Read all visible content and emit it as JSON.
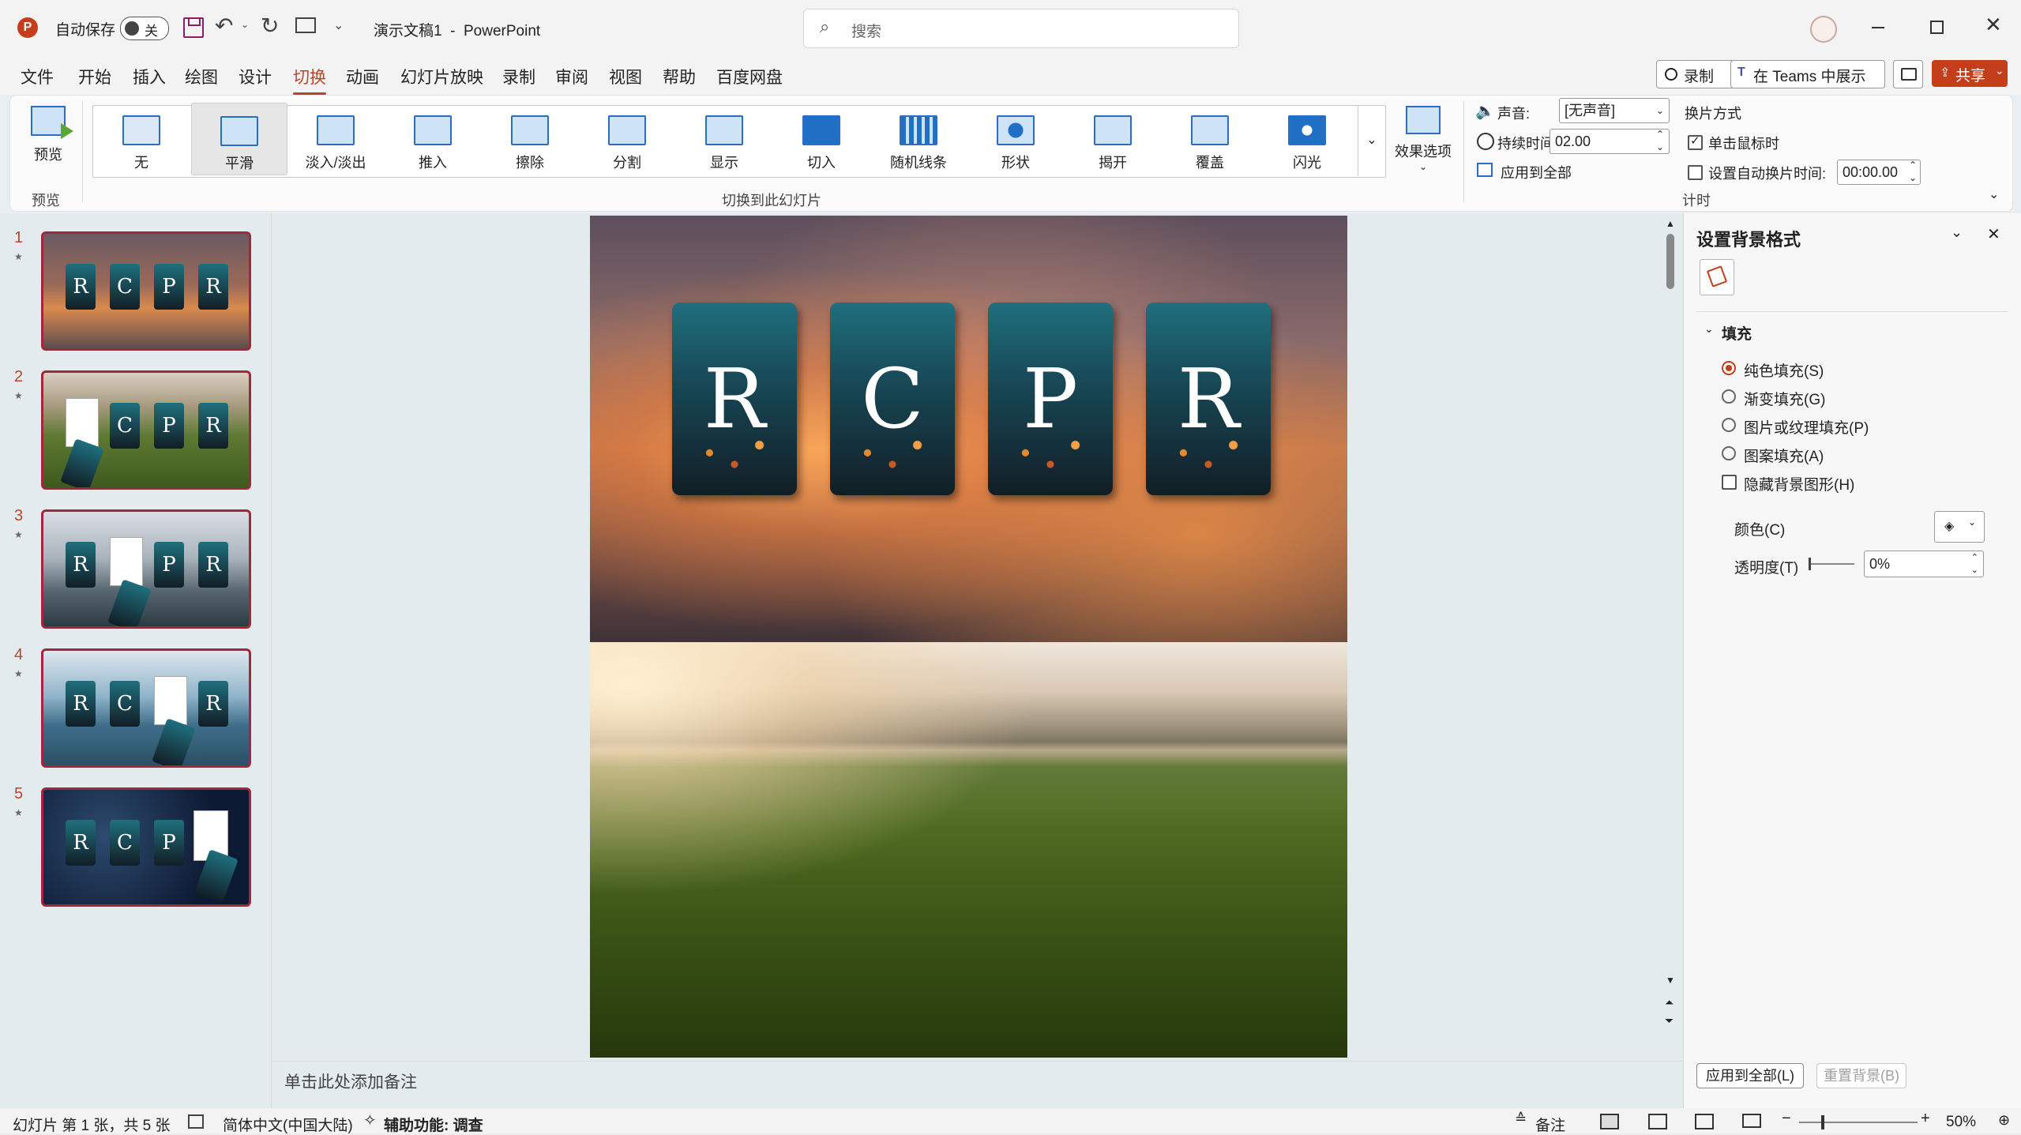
{
  "app": {
    "autosave_label": "自动保存",
    "autosave_state": "关",
    "doc_title": "演示文稿1  -  PowerPoint",
    "search_placeholder": "搜索"
  },
  "menu": [
    "文件",
    "开始",
    "插入",
    "绘图",
    "设计",
    "切换",
    "动画",
    "幻灯片放映",
    "录制",
    "审阅",
    "视图",
    "帮助",
    "百度网盘"
  ],
  "menu_active": "切换",
  "top_right": {
    "record": "录制",
    "teams": "在 Teams 中展示",
    "share": "共享"
  },
  "ribbon": {
    "preview_label": "预览",
    "preview_group": "预览",
    "transitions": [
      "无",
      "平滑",
      "淡入/淡出",
      "推入",
      "擦除",
      "分割",
      "显示",
      "切入",
      "随机线条",
      "形状",
      "揭开",
      "覆盖",
      "闪光"
    ],
    "selected_transition": "平滑",
    "transitions_group": "切换到此幻灯片",
    "effect_options": "效果选项",
    "sound_label": "声音:",
    "sound_value": "[无声音]",
    "duration_label": "持续时间(D):",
    "duration_value": "02.00",
    "apply_all": "应用到全部",
    "advance_title": "换片方式",
    "on_click": "单击鼠标时",
    "auto_after": "设置自动换片时间:",
    "auto_after_value": "00:00.00",
    "timing_group": "计时"
  },
  "slides": [
    {
      "num": "1",
      "letters": [
        "R",
        "C",
        "P",
        "R"
      ]
    },
    {
      "num": "2",
      "letters": [
        "",
        "C",
        "P",
        "R"
      ]
    },
    {
      "num": "3",
      "letters": [
        "R",
        "",
        "P",
        "R"
      ]
    },
    {
      "num": "4",
      "letters": [
        "R",
        "C",
        "",
        "R"
      ]
    },
    {
      "num": "5",
      "letters": [
        "R",
        "C",
        "P",
        ""
      ]
    }
  ],
  "slide_cards": [
    "R",
    "C",
    "P",
    "R"
  ],
  "notes_placeholder": "单击此处添加备注",
  "format_panel": {
    "title": "设置背景格式",
    "section": "填充",
    "options": [
      "纯色填充(S)",
      "渐变填充(G)",
      "图片或纹理填充(P)",
      "图案填充(A)"
    ],
    "selected_option": "纯色填充(S)",
    "hide_bg": "隐藏背景图形(H)",
    "color_label": "颜色(C)",
    "transparency_label": "透明度(T)",
    "transparency_value": "0%",
    "apply_all": "应用到全部(L)",
    "reset": "重置背景(B)"
  },
  "status": {
    "slide_info": "幻灯片 第 1 张，共 5 张",
    "language": "简体中文(中国大陆)",
    "accessibility": "辅助功能: 调查",
    "notes": "备注",
    "zoom": "50%"
  },
  "colors": {
    "accent": "#b7472a",
    "share": "#c43e1c",
    "thumb_border": "#a4263c"
  }
}
